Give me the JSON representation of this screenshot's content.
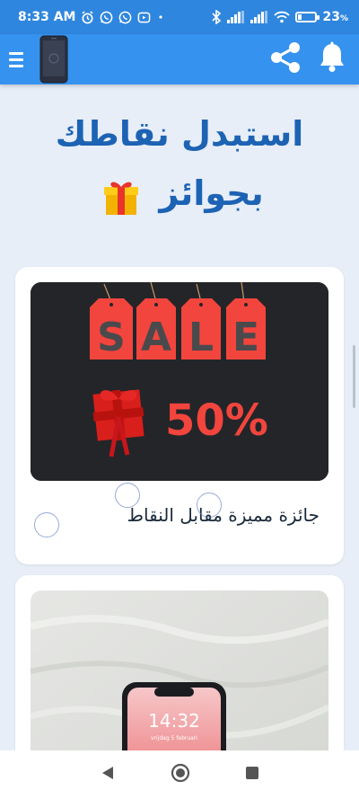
{
  "status_bar": {
    "time": "8:33 AM",
    "battery": "23",
    "battery_percent_sign": "%",
    "battery_level": 0.23
  },
  "app_bar": {
    "menu_icon": "hamburger-icon",
    "logo_icon": "phone-icon",
    "share_icon": "share-icon",
    "notification_icon": "bell-icon"
  },
  "headline": {
    "line1": "استبدل نقاطك",
    "line2": "بجوائز"
  },
  "cards": [
    {
      "image_sale_text": "SALE",
      "image_discount": "50%",
      "caption": "جائزة مميزة مقابل النقاط"
    },
    {
      "image_phone_time": "14:32",
      "image_phone_date": "vrijdag 5 februari"
    }
  ],
  "colors": {
    "status_bar": "#2f86de",
    "app_bar": "#3592ee",
    "background": "#e7eef8",
    "headline": "#1d63b4",
    "sale_red": "#f2453d"
  }
}
